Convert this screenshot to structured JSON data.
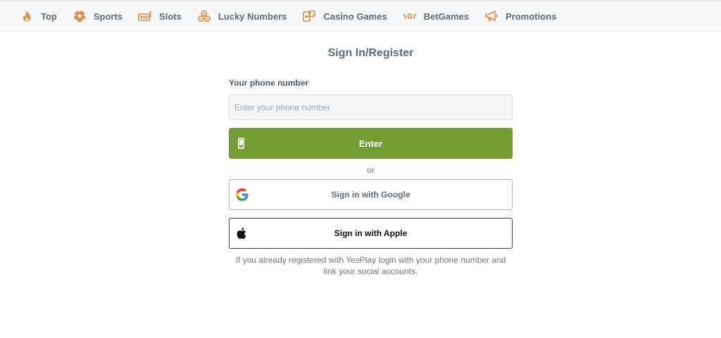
{
  "nav": {
    "items": [
      {
        "label": "Top",
        "icon": "fire-icon"
      },
      {
        "label": "Sports",
        "icon": "soccer-ball-icon"
      },
      {
        "label": "Slots",
        "icon": "slot-machine-icon"
      },
      {
        "label": "Lucky Numbers",
        "icon": "lottery-balls-icon"
      },
      {
        "label": "Casino Games",
        "icon": "casino-games-icon"
      },
      {
        "label": "BetGames",
        "icon": "betgames-icon"
      },
      {
        "label": "Promotions",
        "icon": "megaphone-icon"
      }
    ],
    "icon_color": "#e8883a"
  },
  "auth": {
    "title": "Sign In/Register",
    "phone_label": "Your phone number",
    "phone_placeholder": "Enter your phone number",
    "phone_value": "",
    "enter_label": "Enter",
    "or_text": "or",
    "google_label": "Sign in with Google",
    "apple_label": "Sign in with Apple",
    "info_text": "If you already registered with YesPlay login with your phone number and link your social accounts."
  },
  "colors": {
    "accent_green": "#729e31",
    "text": "#5f6b76",
    "nav_bg": "#f7f8f9"
  }
}
